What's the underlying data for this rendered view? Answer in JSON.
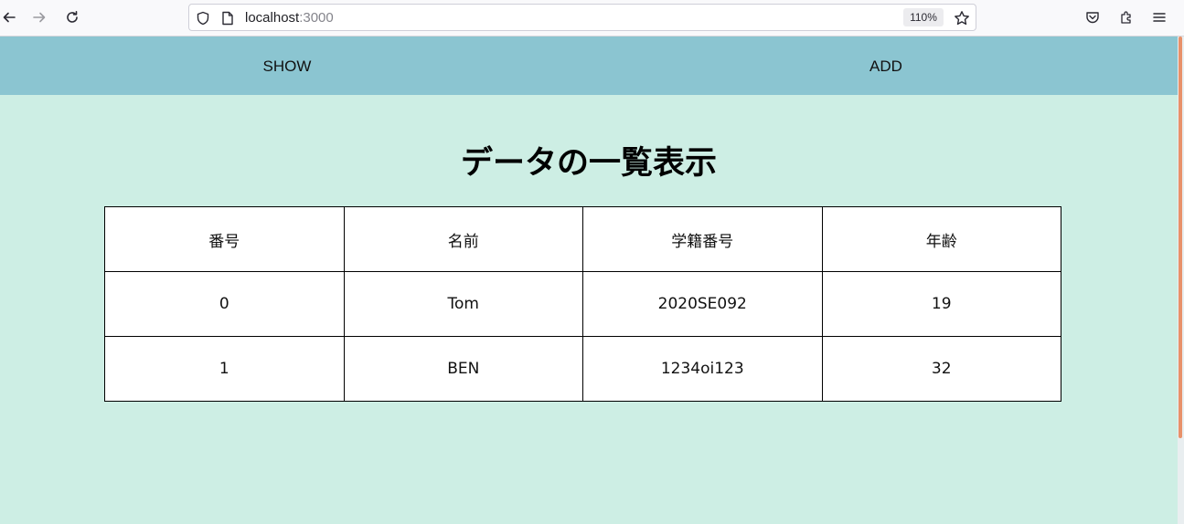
{
  "browser": {
    "url_host": "localhost",
    "url_port": ":3000",
    "zoom": "110%",
    "icons": {
      "back": "back-arrow-icon",
      "forward": "forward-arrow-icon",
      "reload": "reload-icon",
      "shield": "shield-icon",
      "page": "page-icon",
      "bookmark": "star-icon",
      "pocket": "pocket-icon",
      "extensions": "extensions-icon",
      "menu": "hamburger-menu-icon"
    }
  },
  "nav": {
    "show_label": "SHOW",
    "add_label": "ADD",
    "background": "#8bc5d1"
  },
  "main": {
    "title": "データの一覧表示",
    "background": "#cdeee4",
    "table": {
      "headers": [
        "番号",
        "名前",
        "学籍番号",
        "年齢"
      ],
      "rows": [
        [
          "0",
          "Tom",
          "2020SE092",
          "19"
        ],
        [
          "1",
          "BEN",
          "1234oi123",
          "32"
        ]
      ]
    }
  },
  "colors": {
    "scrollbar_thumb": "#e8916a"
  }
}
